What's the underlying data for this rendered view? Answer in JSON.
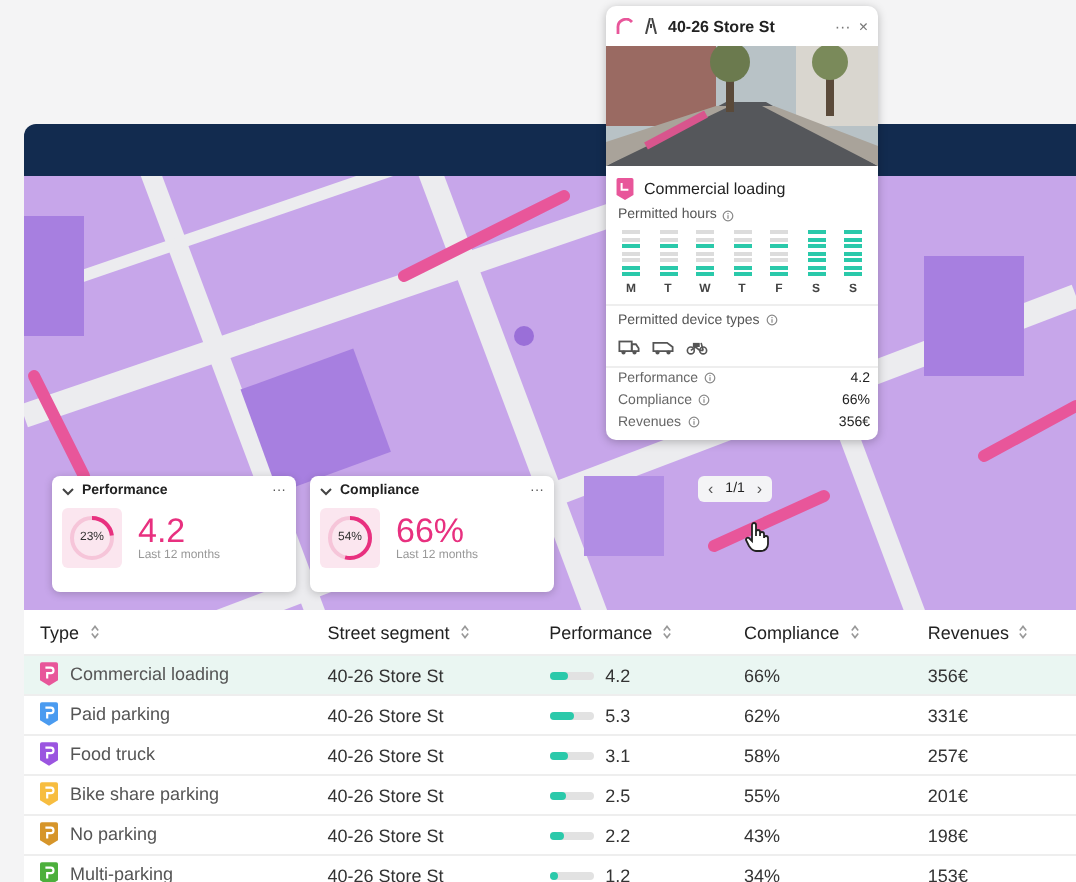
{
  "popup": {
    "title": "40-26 Store St",
    "more": "···",
    "close": "×",
    "zone_type": "Commercial loading",
    "hours_label": "Permitted hours",
    "days": [
      {
        "label": "M",
        "slots": [
          false,
          false,
          true,
          false,
          false,
          true,
          true
        ]
      },
      {
        "label": "T",
        "slots": [
          false,
          false,
          true,
          false,
          false,
          true,
          true
        ]
      },
      {
        "label": "W",
        "slots": [
          false,
          false,
          true,
          false,
          false,
          true,
          true
        ]
      },
      {
        "label": "T",
        "slots": [
          false,
          false,
          true,
          false,
          false,
          true,
          true
        ]
      },
      {
        "label": "F",
        "slots": [
          false,
          false,
          true,
          false,
          false,
          true,
          true
        ]
      },
      {
        "label": "S",
        "slots": [
          true,
          true,
          true,
          true,
          true,
          true,
          true
        ]
      },
      {
        "label": "S",
        "slots": [
          true,
          true,
          true,
          true,
          true,
          true,
          true
        ]
      }
    ],
    "devices_label": "Permitted device types",
    "devices": [
      {
        "kind": "truck"
      },
      {
        "kind": "van"
      },
      {
        "kind": "cargo-bike"
      }
    ],
    "stats": [
      {
        "label": "Performance",
        "value": "4.2"
      },
      {
        "label": "Compliance",
        "value": "66%"
      },
      {
        "label": "Revenues",
        "value": "356€"
      }
    ]
  },
  "pager": {
    "prev": "‹",
    "text": "1/1",
    "next": "›"
  },
  "kpis": [
    {
      "title": "Performance",
      "more": "···",
      "level": 0.23,
      "percent": "23%",
      "value": "4.2",
      "caption": "Last 12 months"
    },
    {
      "title": "Compliance",
      "more": "···",
      "level": 0.54,
      "percent": "54%",
      "value": "66%",
      "caption": "Last 12 months"
    }
  ],
  "table": {
    "columns": [
      "Type",
      "Street segment",
      "Performance",
      "Compliance",
      "Revenues"
    ],
    "rows": [
      {
        "type": "Commercial loading",
        "color": "#e8569a",
        "street": "40-26 Store St",
        "level": 0.45,
        "performance": "4.2",
        "compliance": "66%",
        "revenues": "356€",
        "selected": true
      },
      {
        "type": "Paid parking",
        "color": "#4a9bf0",
        "street": "40-26 Store St",
        "level": 0.55,
        "performance": "5.3",
        "compliance": "62%",
        "revenues": "331€",
        "selected": false
      },
      {
        "type": "Food truck",
        "color": "#9b55e0",
        "street": "40-26 Store St",
        "level": 0.45,
        "performance": "3.1",
        "compliance": "58%",
        "revenues": "257€",
        "selected": false
      },
      {
        "type": "Bike share parking",
        "color": "#f7bd40",
        "street": "40-26 Store St",
        "level": 0.4,
        "performance": "2.5",
        "compliance": "55%",
        "revenues": "201€",
        "selected": false
      },
      {
        "type": "No parking",
        "color": "#d6952a",
        "street": "40-26 Store St",
        "level": 0.35,
        "performance": "2.2",
        "compliance": "43%",
        "revenues": "198€",
        "selected": false
      },
      {
        "type": "Multi-parking",
        "color": "#4caf3c",
        "street": "40-26 Store St",
        "level": 0.2,
        "performance": "1.2",
        "compliance": "34%",
        "revenues": "153€",
        "selected": false
      }
    ]
  }
}
